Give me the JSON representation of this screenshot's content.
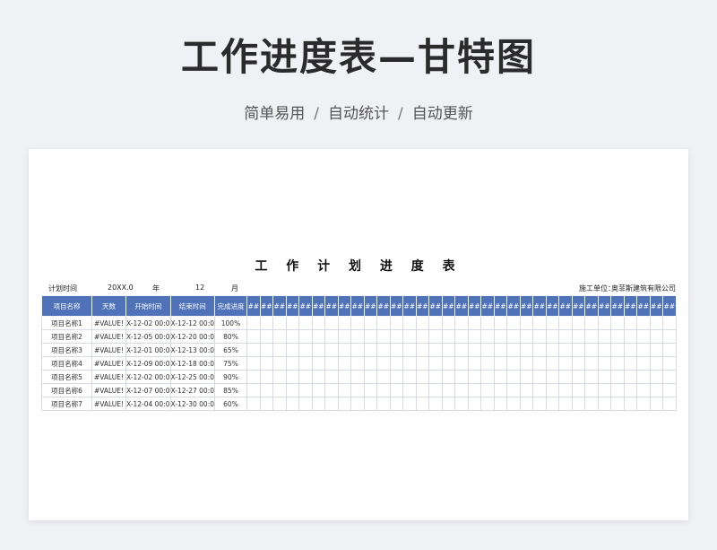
{
  "hero": {
    "title": "工作进度表—甘特图",
    "subtitle": [
      "简单易用",
      "自动统计",
      "自动更新"
    ],
    "separator": "/"
  },
  "sheet": {
    "title": "工 作 计 划 进 度 表",
    "meta": {
      "plan_time_label": "计划时间",
      "year_value": "20XX.0",
      "year_unit": "年",
      "month_value": "12",
      "month_unit": "月",
      "company_label": "施工单位：",
      "company_name": "奥菲斯建筑有限公司"
    },
    "columns": [
      "项目名称",
      "天数",
      "开始时间",
      "结束时间",
      "完成进度"
    ],
    "day_header_label": "##",
    "day_column_count": 33,
    "rows": [
      {
        "name": "项目名称1",
        "days": "#VALUE!",
        "start": "X-12-02 00:0",
        "end": "X-12-12 00:0",
        "progress": "100%"
      },
      {
        "name": "项目名称2",
        "days": "#VALUE!",
        "start": "X-12-05 00:0",
        "end": "X-12-20 00:0",
        "progress": "80%"
      },
      {
        "name": "项目名称3",
        "days": "#VALUE!",
        "start": "X-12-01 00:0",
        "end": "X-12-13 00:0",
        "progress": "65%"
      },
      {
        "name": "项目名称4",
        "days": "#VALUE!",
        "start": "X-12-09 00:0",
        "end": "X-12-18 00:0",
        "progress": "75%"
      },
      {
        "name": "项目名称5",
        "days": "#VALUE!",
        "start": "X-12-02 00:0",
        "end": "X-12-25 00:0",
        "progress": "90%"
      },
      {
        "name": "项目名称6",
        "days": "#VALUE!",
        "start": "X-12-07 00:0",
        "end": "X-12-27 00:0",
        "progress": "85%"
      },
      {
        "name": "项目名称7",
        "days": "#VALUE!",
        "start": "X-12-04 00:0",
        "end": "X-12-30 00:0",
        "progress": "60%"
      }
    ],
    "colors": {
      "header_bg": "#4f72b8",
      "header_text": "#ffffff",
      "grid_line": "#d7dbe3"
    }
  }
}
